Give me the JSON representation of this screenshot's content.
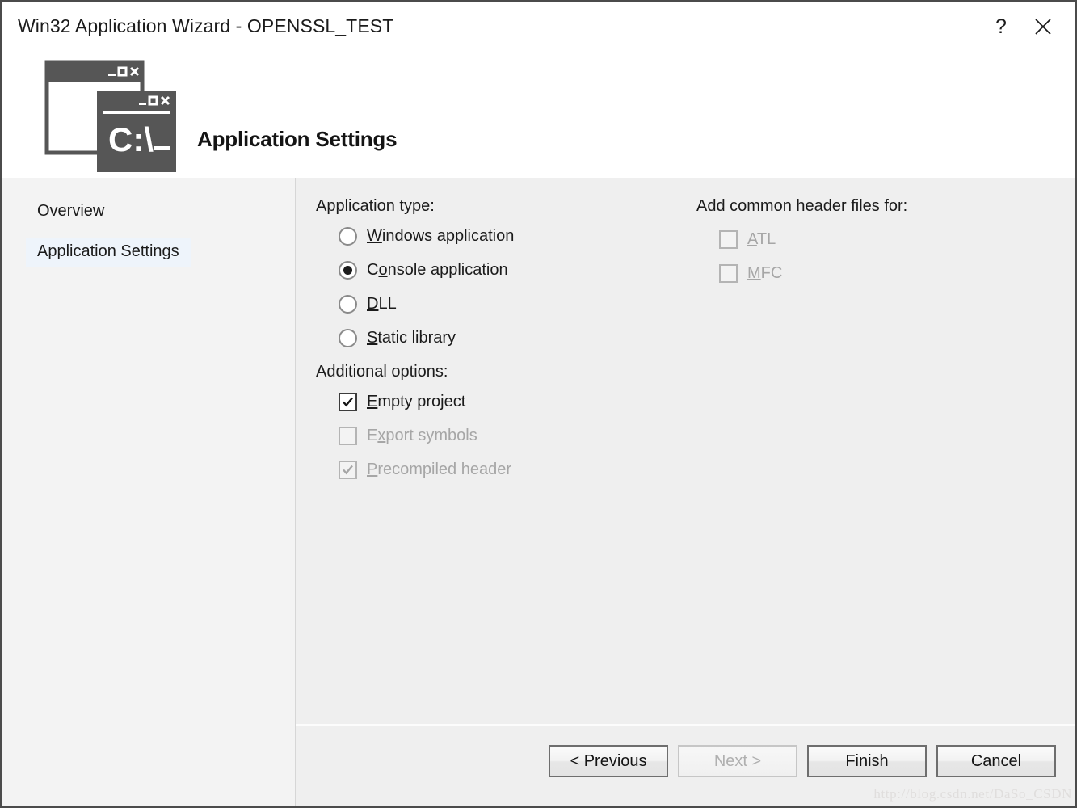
{
  "window": {
    "title": "Win32 Application Wizard - OPENSSL_TEST",
    "help_label": "?",
    "close_label": "✕"
  },
  "banner": {
    "heading": "Application Settings",
    "icon": "console-window-icon",
    "icon_text": "C:\\_"
  },
  "sidebar": {
    "items": [
      {
        "label": "Overview",
        "selected": false
      },
      {
        "label": "Application Settings",
        "selected": true
      }
    ]
  },
  "main": {
    "application_type": {
      "label": "Application type:",
      "options": [
        {
          "label": "Windows application",
          "acc_before": "",
          "acc": "W",
          "acc_after": "indows application",
          "checked": false,
          "disabled": false
        },
        {
          "label": "Console application",
          "acc_before": "C",
          "acc": "o",
          "acc_after": "nsole application",
          "checked": true,
          "disabled": false
        },
        {
          "label": "DLL",
          "acc_before": "",
          "acc": "D",
          "acc_after": "LL",
          "checked": false,
          "disabled": false
        },
        {
          "label": "Static library",
          "acc_before": "",
          "acc": "S",
          "acc_after": "tatic library",
          "checked": false,
          "disabled": false
        }
      ]
    },
    "additional_options": {
      "label": "Additional options:",
      "options": [
        {
          "label": "Empty project",
          "acc_before": "",
          "acc": "E",
          "acc_after": "mpty project",
          "checked": true,
          "disabled": false
        },
        {
          "label": "Export symbols",
          "acc_before": "E",
          "acc": "x",
          "acc_after": "port symbols",
          "checked": false,
          "disabled": true
        },
        {
          "label": "Precompiled header",
          "acc_before": "",
          "acc": "P",
          "acc_after": "recompiled header",
          "checked": true,
          "disabled": true
        }
      ]
    },
    "header_files": {
      "label": "Add common header files for:",
      "options": [
        {
          "label": "ATL",
          "acc_before": "",
          "acc": "A",
          "acc_after": "TL",
          "checked": false,
          "disabled": true
        },
        {
          "label": "MFC",
          "acc_before": "",
          "acc": "M",
          "acc_after": "FC",
          "checked": false,
          "disabled": true
        }
      ]
    }
  },
  "footer": {
    "buttons": [
      {
        "label": "< Previous",
        "disabled": false
      },
      {
        "label": "Next >",
        "disabled": true
      },
      {
        "label": "Finish",
        "disabled": false
      },
      {
        "label": "Cancel",
        "disabled": false
      }
    ]
  },
  "watermark": "http://blog.csdn.net/DaSo_CSDN",
  "colors": {
    "header_bg": "#ffffff",
    "sidebar_bg": "#f3f3f3",
    "content_bg": "#efefef",
    "selection_bg": "#eef4fb",
    "icon_fill": "#565656",
    "text": "#1b1b1b",
    "disabled_text": "#a6a6a6"
  }
}
